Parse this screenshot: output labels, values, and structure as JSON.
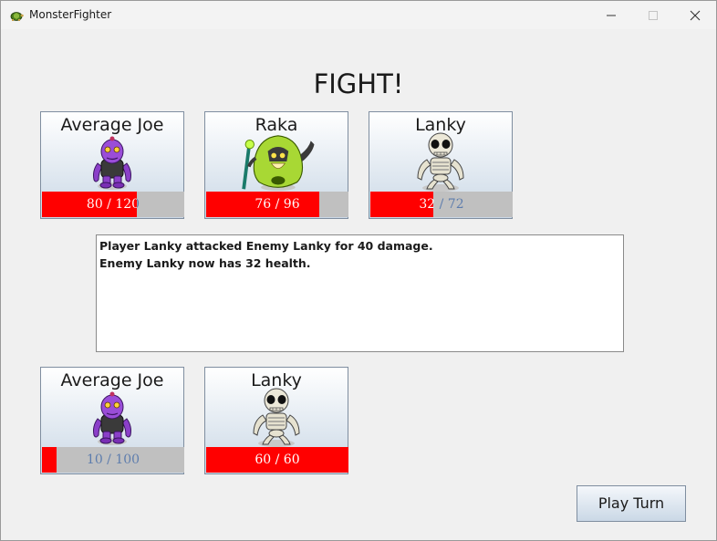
{
  "window": {
    "title": "MonsterFighter",
    "app_icon": "turtle-icon"
  },
  "controls": {
    "minimize": "minimize-icon",
    "maximize": "maximize-icon",
    "close": "close-icon"
  },
  "heading": "FIGHT!",
  "enemies": [
    {
      "name": "Average Joe",
      "icon": "purple-ogre-icon",
      "hp": 80,
      "max": 120,
      "hp_text": "80 / 120"
    },
    {
      "name": "Raka",
      "icon": "green-wizard-icon",
      "hp": 76,
      "max": 96,
      "hp_text": "76 / 96"
    },
    {
      "name": "Lanky",
      "icon": "skeleton-icon",
      "hp": 32,
      "max": 72,
      "hp_text": "32 / 72"
    }
  ],
  "battle_log": [
    "Player Lanky attacked Enemy Lanky for 40 damage.",
    "Enemy Lanky now has 32 health."
  ],
  "players": [
    {
      "name": "Average Joe",
      "icon": "purple-ogre-icon",
      "hp": 10,
      "max": 100,
      "hp_text": "10 / 100"
    },
    {
      "name": "Lanky",
      "icon": "skeleton-icon",
      "hp": 60,
      "max": 60,
      "hp_text": "60 / 60"
    }
  ],
  "buttons": {
    "play_turn": "Play Turn"
  },
  "colors": {
    "hp_fill": "#ff0000",
    "hp_empty": "#c0c0c0",
    "text_on_fill": "#ffffff",
    "text_on_empty": "#5c7cad"
  }
}
